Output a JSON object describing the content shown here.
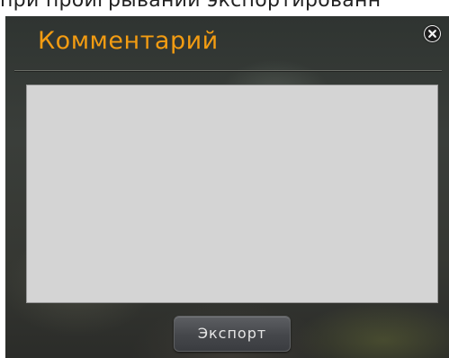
{
  "page": {
    "top_text": "при проигрывании экспортированн"
  },
  "dialog": {
    "title": "Комментарий",
    "close_icon": "close-icon",
    "comment_field": {
      "value": "",
      "placeholder": ""
    },
    "export_label": "Экспорт"
  },
  "colors": {
    "title": "#f39c12",
    "comment_background": "#d4d4d4",
    "dialog_background": "#363833",
    "button_background": "#45474b"
  }
}
